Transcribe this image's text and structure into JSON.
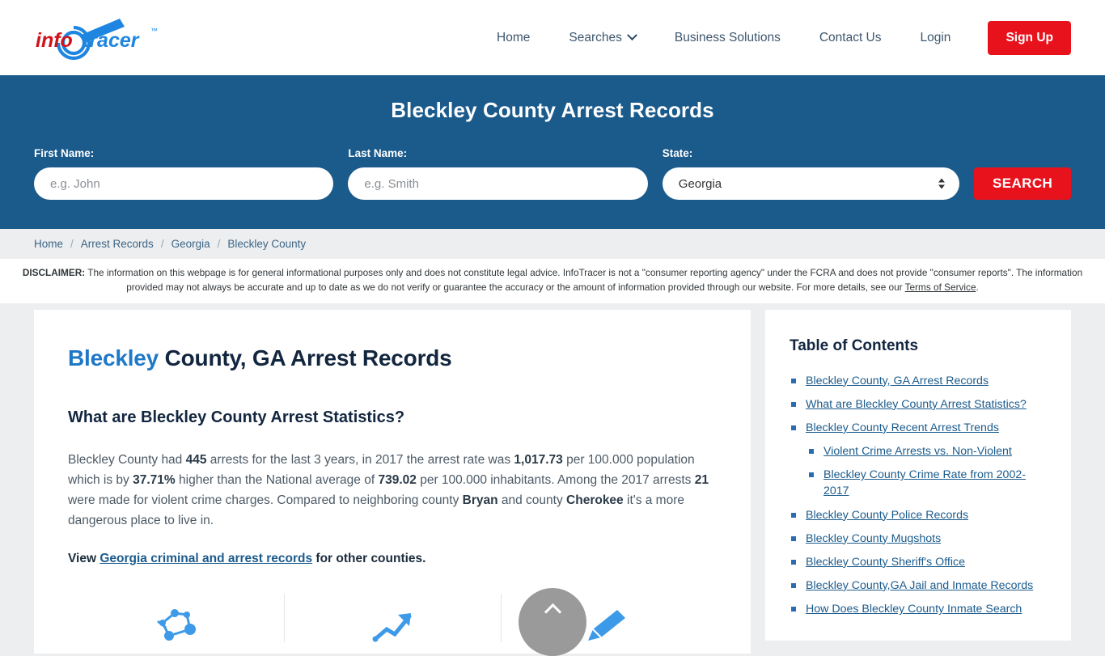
{
  "header": {
    "logo_text": "infotracer",
    "logo_tm": "™",
    "nav": [
      {
        "label": "Home",
        "has_caret": false
      },
      {
        "label": "Searches",
        "has_caret": true
      },
      {
        "label": "Business Solutions",
        "has_caret": false
      },
      {
        "label": "Contact Us",
        "has_caret": false
      },
      {
        "label": "Login",
        "has_caret": false
      }
    ],
    "signup_label": "Sign Up"
  },
  "hero": {
    "title": "Bleckley County Arrest Records",
    "first_name_label": "First Name:",
    "first_name_placeholder": "e.g. John",
    "first_name_value": "",
    "last_name_label": "Last Name:",
    "last_name_placeholder": "e.g. Smith",
    "last_name_value": "",
    "state_label": "State:",
    "state_value": "Georgia",
    "state_options": [
      "Georgia"
    ],
    "search_label": "SEARCH"
  },
  "breadcrumb": {
    "items": [
      "Home",
      "Arrest Records",
      "Georgia",
      "Bleckley County"
    ],
    "separator": "/"
  },
  "disclaimer": {
    "label": "DISCLAIMER:",
    "text": " The information on this webpage is for general informational purposes only and does not constitute legal advice. InfoTracer is not a \"consumer reporting agency\" under the FCRA and does not provide \"consumer reports\". The information provided may not always be accurate and up to date as we do not verify or guarantee the accuracy or the amount of information provided through our website. For more details, see our ",
    "link_text": "Terms of Service",
    "tail": "."
  },
  "main": {
    "title_highlight": "Bleckley",
    "title_rest": " County, GA Arrest Records",
    "section_heading": "What are Bleckley County Arrest Statistics?",
    "paragraph": {
      "p1": "Bleckley County had ",
      "arrests": "445",
      "p2": " arrests for the last 3 years, in 2017 the arrest rate was ",
      "arrest_rate": "1,017.73",
      "p3": " per 100.000 population which is by ",
      "percent_higher": "37.71%",
      "p4": " higher than the National average of ",
      "national_average": "739.02",
      "p5": " per 100.000 inhabitants. Among the 2017 arrests ",
      "violent_arrests": "21",
      "p6": " were made for violent crime charges. Compared to neighboring county ",
      "county_a": "Bryan",
      "p7": " and county ",
      "county_b": "Cherokee",
      "p8": " it's a more dangerous place to live in."
    },
    "view_prefix": "View ",
    "view_link": "Georgia criminal and arrest records",
    "view_suffix": " for other counties.",
    "icons": [
      "network-chart-icon",
      "trend-arrow-up-icon",
      "pen-icon"
    ]
  },
  "toc": {
    "title": "Table of Contents",
    "items": [
      {
        "label": "Bleckley County, GA Arrest Records",
        "sub": false
      },
      {
        "label": "What are Bleckley County Arrest Statistics?",
        "sub": false
      },
      {
        "label": "Bleckley County Recent Arrest Trends",
        "sub": false
      },
      {
        "label": "Violent Crime Arrests vs. Non-Violent",
        "sub": true
      },
      {
        "label": "Bleckley County Crime Rate from 2002-2017",
        "sub": true
      },
      {
        "label": "Bleckley County Police Records",
        "sub": false
      },
      {
        "label": "Bleckley County Mugshots",
        "sub": false
      },
      {
        "label": "Bleckley County Sheriff's Office",
        "sub": false
      },
      {
        "label": "Bleckley County,GA Jail and Inmate Records",
        "sub": false
      },
      {
        "label": "How Does Bleckley County Inmate Search",
        "sub": false
      }
    ]
  },
  "scroll_top": {
    "icon": "chevron-up-icon"
  },
  "colors": {
    "hero_blue": "#1b5b8c",
    "accent_red": "#e8121c",
    "link_blue": "#1b5b8c",
    "title_blue": "#1e78c8",
    "page_bg": "#eceef0"
  }
}
